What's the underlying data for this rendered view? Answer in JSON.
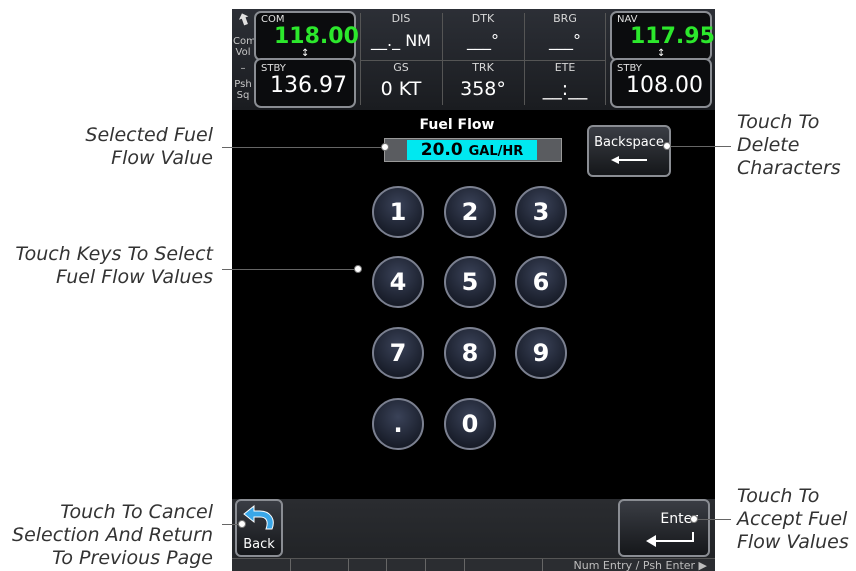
{
  "callouts": {
    "selected_value": [
      "Selected Fuel",
      "Flow Value"
    ],
    "touch_keys": [
      "Touch Keys To Select",
      "Fuel Flow Values"
    ],
    "cancel": [
      "Touch To Cancel",
      "Selection And Return",
      "To Previous Page"
    ],
    "delete": [
      "Touch To",
      "Delete",
      "Characters"
    ],
    "accept": [
      "Touch To",
      "Accept Fuel",
      "Flow Values"
    ]
  },
  "topbar": {
    "side_labels": [
      "Com",
      "Vol",
      "–",
      "Psh",
      "Sq"
    ],
    "com": {
      "label": "COM",
      "active": "118.00",
      "stby_label": "STBY",
      "standby": "136.97"
    },
    "nav": {
      "label": "NAV",
      "active": "117.95",
      "stby_label": "STBY",
      "standby": "108.00"
    },
    "swap_symbol": "↕",
    "fields": [
      {
        "label": "DIS",
        "value": "__._ NM"
      },
      {
        "label": "DTK",
        "value": "___°"
      },
      {
        "label": "BRG",
        "value": "___°"
      },
      {
        "label": "GS",
        "value": "0 KT"
      },
      {
        "label": "TRK",
        "value": "358°"
      },
      {
        "label": "ETE",
        "value": "__:__"
      }
    ]
  },
  "fuel_flow": {
    "title": "Fuel Flow",
    "value": "20.0",
    "unit": "GAL/HR"
  },
  "backspace_label": "Backspace",
  "keypad": [
    "1",
    "2",
    "3",
    "4",
    "5",
    "6",
    "7",
    "8",
    "9",
    ".",
    "0"
  ],
  "back_label": "Back",
  "enter_label": "Enter",
  "status": "Num Entry / Psh Enter ▶",
  "colors": {
    "active_freq": "#2ce82c",
    "entry_highlight": "#00e8f0",
    "background": "#000000"
  }
}
